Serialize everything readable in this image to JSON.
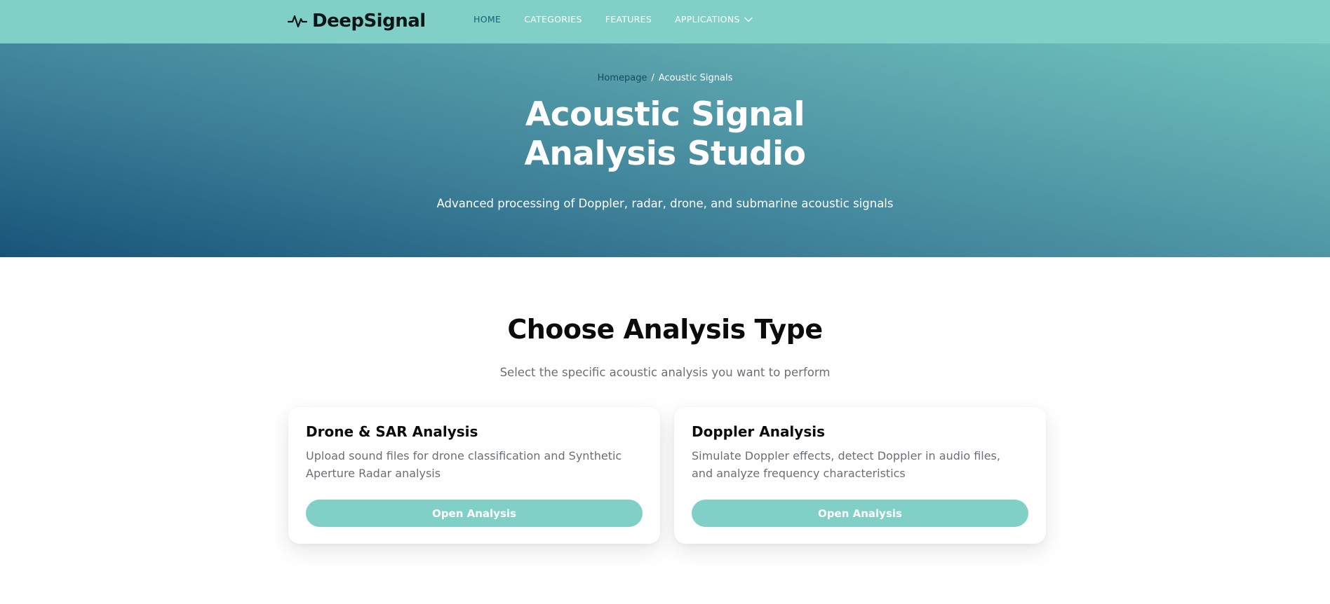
{
  "nav": {
    "brand": "DeepSignal",
    "brand_icon": "pulse-icon",
    "links": [
      "HOME",
      "CATEGORIES",
      "FEATURES",
      "APPLICATIONS"
    ],
    "active_link": "HOME",
    "colors": {
      "navbar_bg": "#80d0c7",
      "active_link": "#1b5e73"
    }
  },
  "hero": {
    "breadcrumb": {
      "home": "Homepage",
      "separator": "/",
      "current": "Acoustic Signals"
    },
    "title_line1": "Acoustic Signal",
    "title_line2": "Analysis Studio",
    "subtitle": "Advanced processing of Doppler, radar, drone, and submarine acoustic signals",
    "colors": {
      "gradient_dark": "#185479",
      "gradient_light": "#71c4bd"
    }
  },
  "section": {
    "title": "Choose Analysis Type",
    "subtitle": "Select the specific acoustic analysis you want to perform"
  },
  "cards": [
    {
      "title": "Drone & SAR Analysis",
      "description": "Upload sound files for drone classification and Synthetic Aperture Radar analysis",
      "button": "Open Analysis"
    },
    {
      "title": "Doppler Analysis",
      "description": "Simulate Doppler effects, detect Doppler in audio files, and analyze frequency characteristics",
      "button": "Open Analysis"
    }
  ]
}
